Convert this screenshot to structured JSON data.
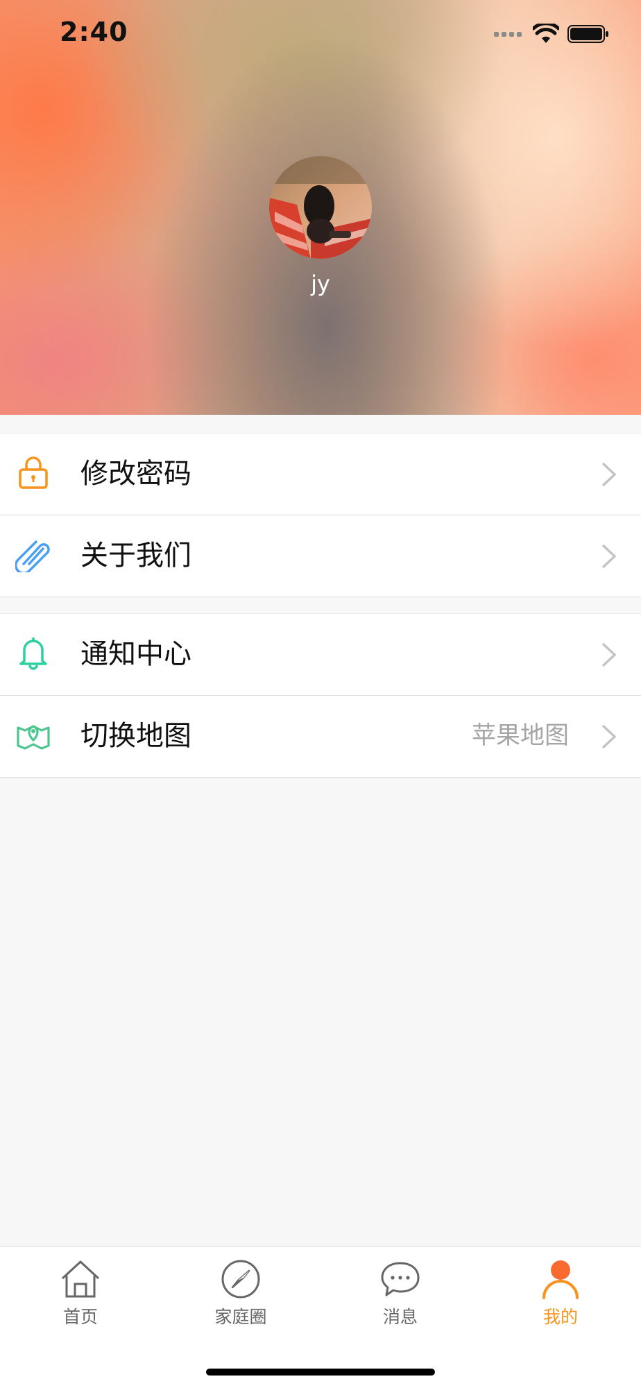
{
  "status_bar": {
    "time": "2:40"
  },
  "profile": {
    "username": "jy"
  },
  "menu_groups": [
    {
      "items": [
        {
          "label": "修改密码",
          "icon": "lock-icon",
          "icon_color": "#f7941d"
        },
        {
          "label": "关于我们",
          "icon": "paperclip-icon",
          "icon_color": "#4a9ff5"
        }
      ]
    },
    {
      "items": [
        {
          "label": "通知中心",
          "icon": "bell-icon",
          "icon_color": "#2fd0a0"
        },
        {
          "label": "切换地图",
          "value": "苹果地图",
          "icon": "map-pin-icon",
          "icon_color": "#4cc68e"
        }
      ]
    }
  ],
  "tab_bar": {
    "active_color": "#f7941d",
    "tabs": [
      {
        "label": "首页",
        "icon": "home-icon"
      },
      {
        "label": "家庭圈",
        "icon": "compass-icon"
      },
      {
        "label": "消息",
        "icon": "chat-bubble-icon"
      },
      {
        "label": "我的",
        "icon": "person-icon",
        "active": true
      }
    ]
  }
}
